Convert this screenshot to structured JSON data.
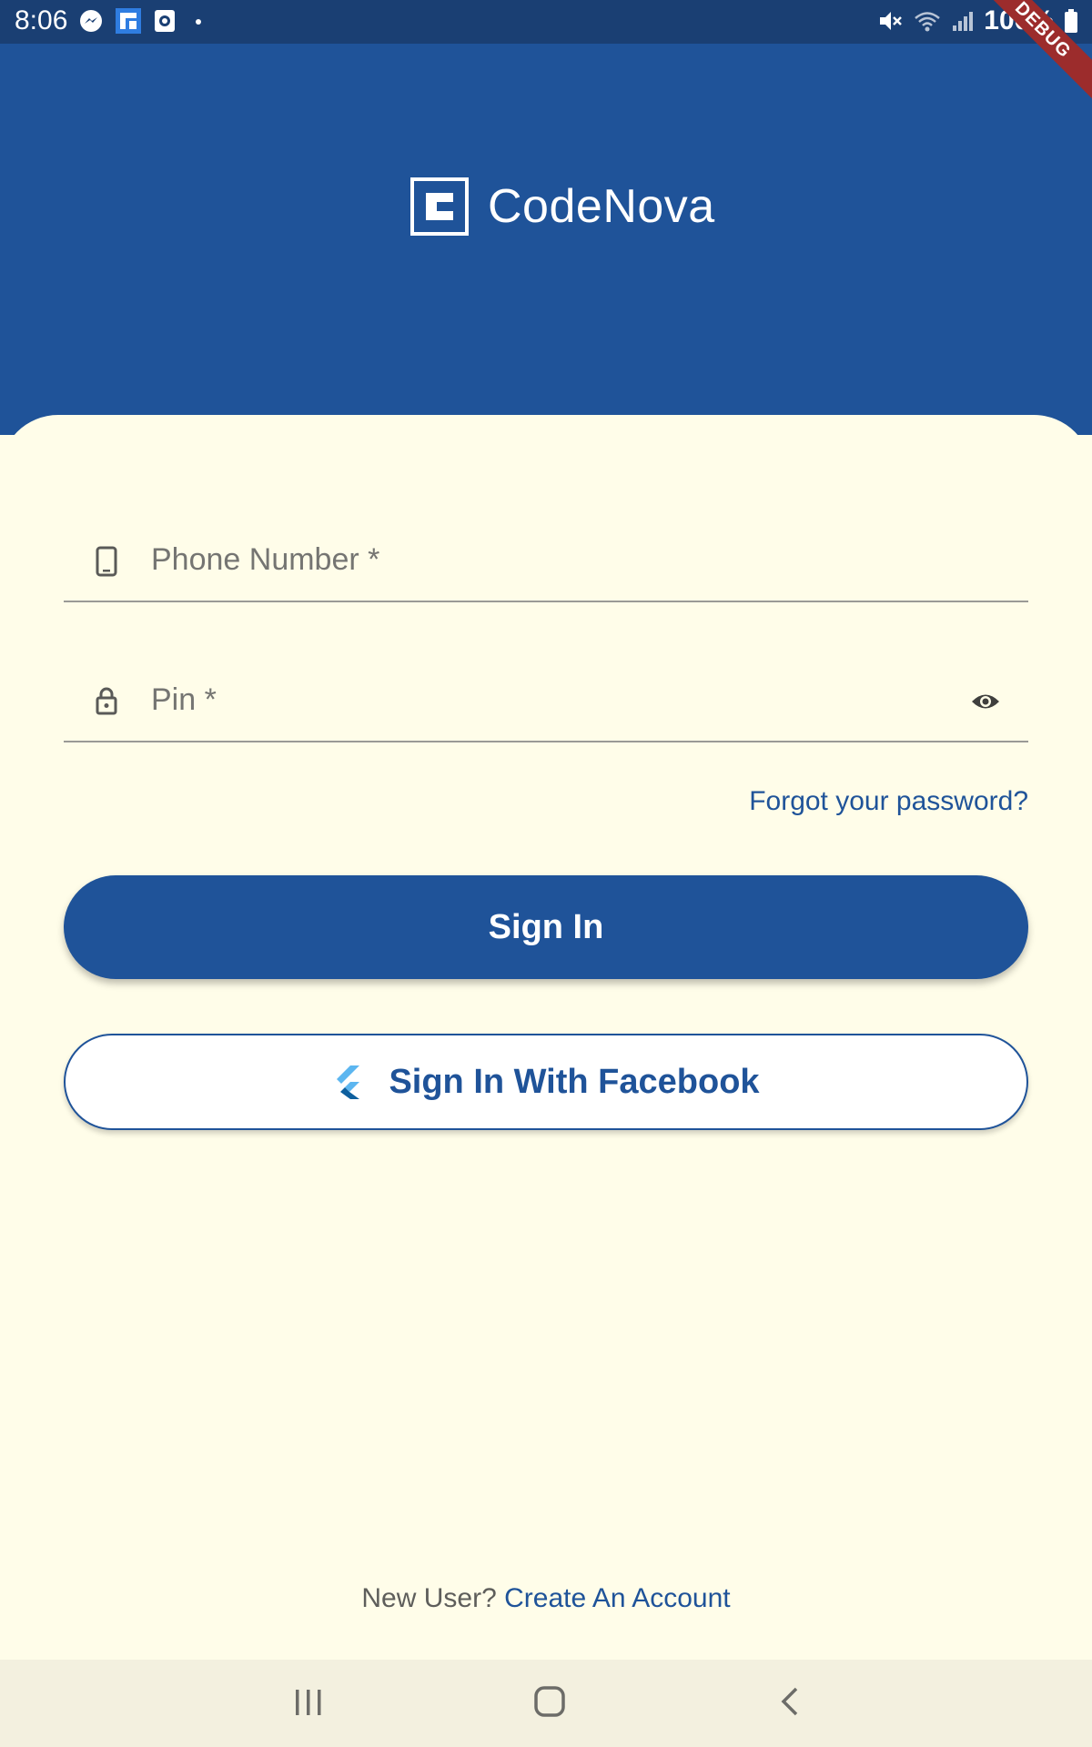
{
  "status_bar": {
    "time": "8:06",
    "left_icons": [
      "messenger-icon",
      "app-icon",
      "clock-app-icon",
      "dot-icon"
    ],
    "right_icons": [
      "mute-icon",
      "wifi-icon",
      "signal-icon",
      "battery-icon"
    ],
    "battery": "100%"
  },
  "debug_banner": "DEBUG",
  "header": {
    "logo_text": "CodeNova",
    "background_color": "#1f5399"
  },
  "form": {
    "phone_label": "Phone Number *",
    "pin_label": "Pin *",
    "forgot_password": "Forgot your password?",
    "sign_in": "Sign In",
    "sign_in_facebook": "Sign In With Facebook"
  },
  "footer": {
    "new_user": "New User?",
    "create_account": "Create An Account"
  },
  "colors": {
    "primary": "#1f5399",
    "background": "#fffde9",
    "nav_bar": "#f3f0df"
  },
  "nav_bar": {
    "buttons": [
      "recents-icon",
      "home-icon",
      "back-icon"
    ]
  }
}
